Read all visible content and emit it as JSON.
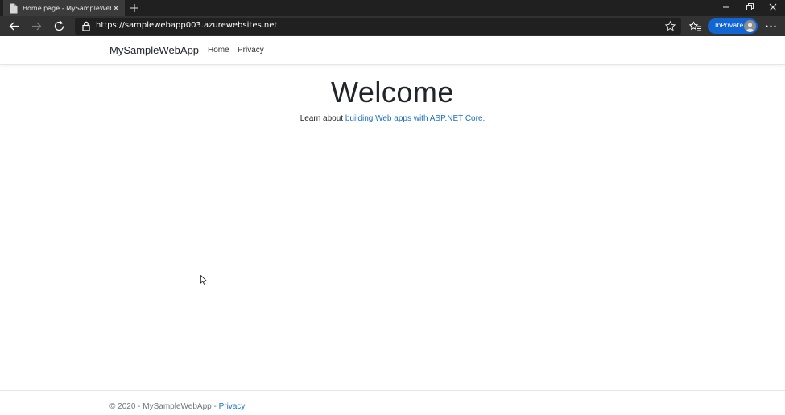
{
  "browser": {
    "tab_title": "Home page - MySampleWebApp",
    "url": "https://samplewebapp003.azurewebsites.net",
    "inprivate_label": "InPrivate"
  },
  "site": {
    "brand": "MySampleWebApp",
    "nav": [
      {
        "label": "Home"
      },
      {
        "label": "Privacy"
      }
    ],
    "heading": "Welcome",
    "intro_text": "Learn about ",
    "intro_link": "building Web apps with ASP.NET Core.",
    "footer_text": "© 2020 - MySampleWebApp - ",
    "footer_link": "Privacy"
  },
  "colors": {
    "link": "#1b6ec2",
    "inprivate": "#1166d4",
    "chrome_dark": "#202020",
    "toolbar": "#323232"
  },
  "icons": [
    "page-icon",
    "close-icon",
    "plus-icon",
    "minimize-icon",
    "restore-icon",
    "back-icon",
    "forward-icon",
    "refresh-icon",
    "lock-icon",
    "star-icon",
    "favorites-icon",
    "more-icon",
    "cursor-icon"
  ]
}
